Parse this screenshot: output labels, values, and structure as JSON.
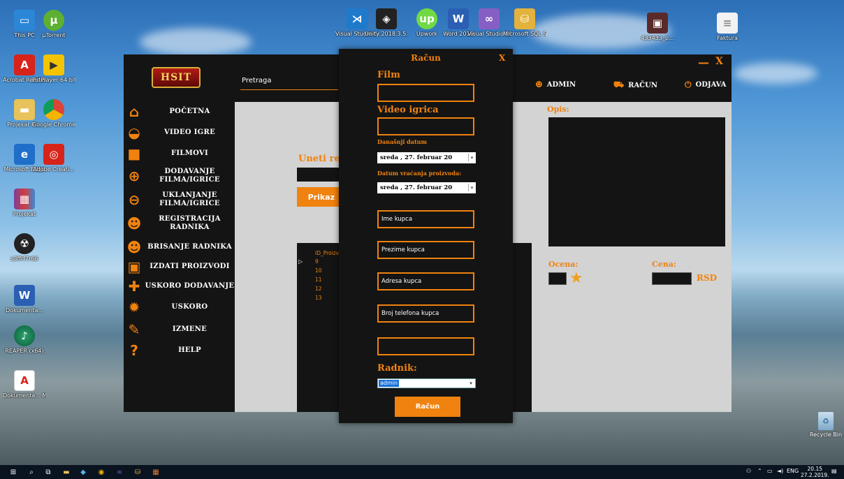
{
  "desktop_icons": {
    "this_pc": "This PC",
    "utorrent": "µTorrent",
    "acrobat": "Acrobat Reader DC",
    "potplayer": "PotPlayer 64 bit",
    "projekat_pi": "Projekat PI...",
    "chrome": "Google Chrome",
    "edge": "Microsoft Edge",
    "adobe_creative": "Adobe Creati...",
    "projekat": "Projekat",
    "s3r": "s3ffrf7r66",
    "dokumentacija": "Dokumenta...",
    "reaper": "REAPER (x64)",
    "dokumentacija_pdf": "Dokumenta... Milošević_...",
    "vscode": "Visual Studio Code",
    "unity": "Unity 2018.3.5...",
    "upwork": "Upwork",
    "word": "Word 2016",
    "vs2017": "Visual Studio 2017",
    "sql": "Microsoft SQL Server ...",
    "file_433": "433433_p...",
    "file_faktura": "Faktura",
    "recycle_bin": "Recycle Bin"
  },
  "app": {
    "logo_text": "HSIT",
    "search_label": "Pretraga",
    "admin_label": "ADMIN",
    "racun_label": "RAČUN",
    "odjava_label": "ODJAVA",
    "minimize": "—",
    "close": "X",
    "nav": [
      {
        "label": "POČETNA",
        "icon": "home-icon"
      },
      {
        "label": "VIDEO IGRE",
        "icon": "gamepad-icon"
      },
      {
        "label": "FILMOVI",
        "icon": "camera-icon"
      },
      {
        "label": "DODAVANJE FILMA/IGRICE",
        "icon": "plus-circle-icon"
      },
      {
        "label": "UKLANJANJE FILMA/IGRICE",
        "icon": "minus-circle-icon"
      },
      {
        "label": "REGISTRACIJA RADNIKA",
        "icon": "user-add-icon"
      },
      {
        "label": "BRISANJE RADNIKA",
        "icon": "user-remove-icon"
      },
      {
        "label": "IZDATI PROIZVODI",
        "icon": "box-icon"
      },
      {
        "label": "USKORO DODAVANJE",
        "icon": "cross-icon"
      },
      {
        "label": "USKORO",
        "icon": "new-badge-icon"
      },
      {
        "label": "IZMENE",
        "icon": "pencil-icon"
      },
      {
        "label": "HELP",
        "icon": "question-icon"
      }
    ],
    "unesi_label": "Uneti re",
    "prikazi_label": "Prikaz",
    "grid": {
      "header": "ID_Proizv",
      "rows": [
        "9",
        "10",
        "11",
        "12",
        "13"
      ]
    },
    "opis_label": "Opis:",
    "ocena_label": "Ocena:",
    "cena_label": "Cena:",
    "rsd_label": "RSD"
  },
  "dialog": {
    "title": "Račun",
    "close": "X",
    "film_label": "Film",
    "video_label": "Video igrica",
    "danasnji_label": "Današnji datum",
    "danasnji_value": "sreda , 27. februar 20",
    "vracanje_label": "Datum vraćanja proizvoda:",
    "vracanje_value": "sreda , 27. februar 20",
    "ime_placeholder": "Ime kupca",
    "prezime_placeholder": "Prezime kupca",
    "adresa_placeholder": "Adresa kupca",
    "telefon_placeholder": "Broj telefona kupca",
    "radnik_label": "Radnik:",
    "radnik_value": "admin",
    "submit_label": "Račun"
  },
  "taskbar": {
    "language": "ENG",
    "time": "20.15",
    "date": "27.2.2019."
  },
  "colors": {
    "accent": "#f0820f",
    "panel": "#141414",
    "content_bg": "#d3d3d3"
  }
}
